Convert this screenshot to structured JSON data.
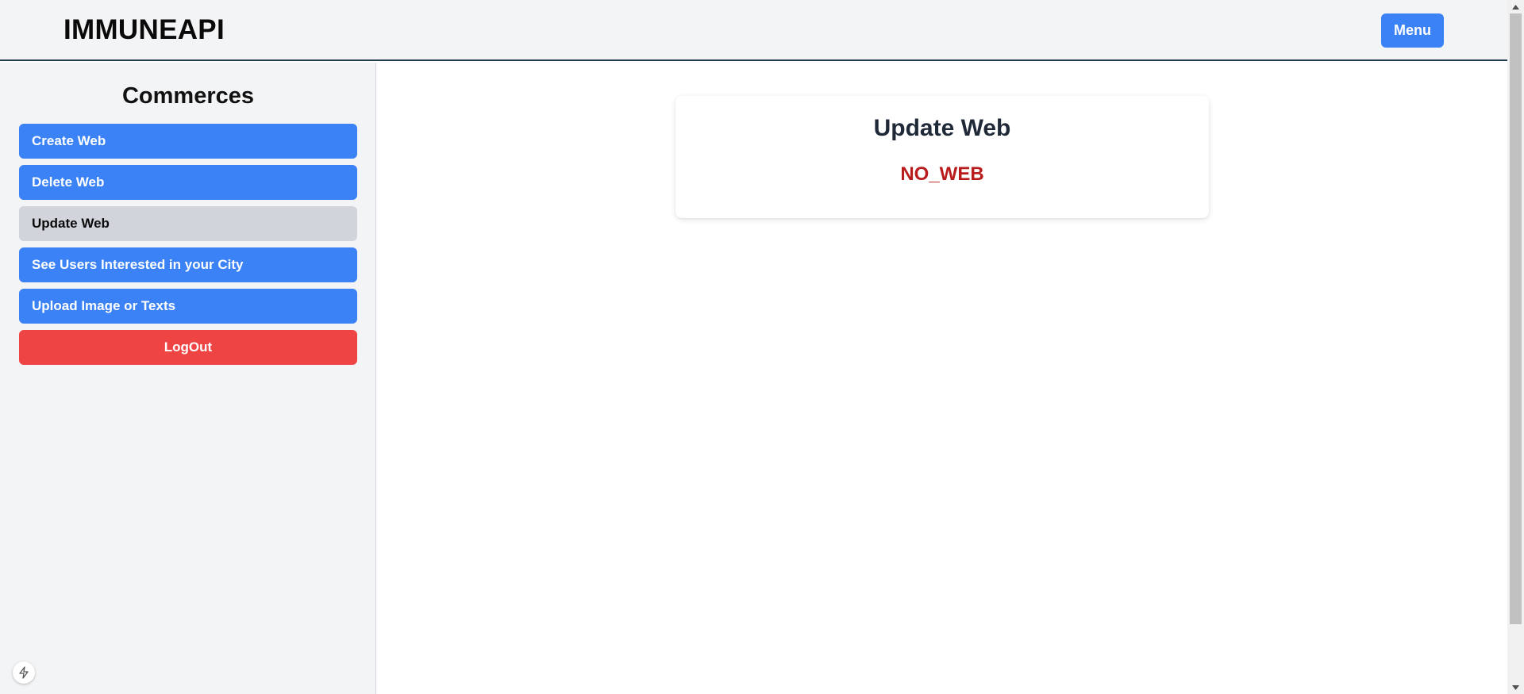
{
  "header": {
    "brand": "IMMUNEAPI",
    "menu_label": "Menu"
  },
  "sidebar": {
    "title": "Commerces",
    "items": [
      {
        "label": "Create Web",
        "state": "default"
      },
      {
        "label": "Delete Web",
        "state": "default"
      },
      {
        "label": "Update Web",
        "state": "active"
      },
      {
        "label": "See Users Interested in your City",
        "state": "default"
      },
      {
        "label": "Upload Image or Texts",
        "state": "default"
      }
    ],
    "logout_label": "LogOut"
  },
  "main": {
    "card_title": "Update Web",
    "error_message": "NO_WEB"
  },
  "colors": {
    "primary": "#3b82f6",
    "active": "#d1d5db",
    "danger": "#ef4444",
    "error_text": "#b91c1c",
    "panel_bg": "#f3f4f6"
  },
  "icons": {
    "float_badge": "lightning-icon",
    "scroll_up": "chevron-up-icon",
    "scroll_down": "chevron-down-icon"
  }
}
